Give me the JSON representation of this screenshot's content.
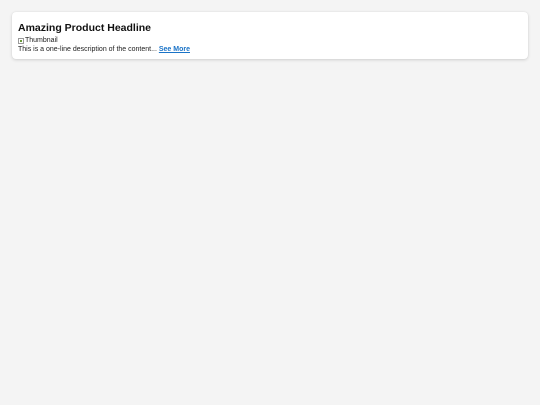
{
  "card": {
    "headline": "Amazing Product Headline",
    "thumbnail_alt": "Thumbnail",
    "description": "This is a one-line description of the content...",
    "see_more_label": "See More"
  },
  "colors": {
    "page_background": "#f4f4f4",
    "card_background": "#ffffff",
    "link": "#1a73c7",
    "text": "#222222"
  }
}
